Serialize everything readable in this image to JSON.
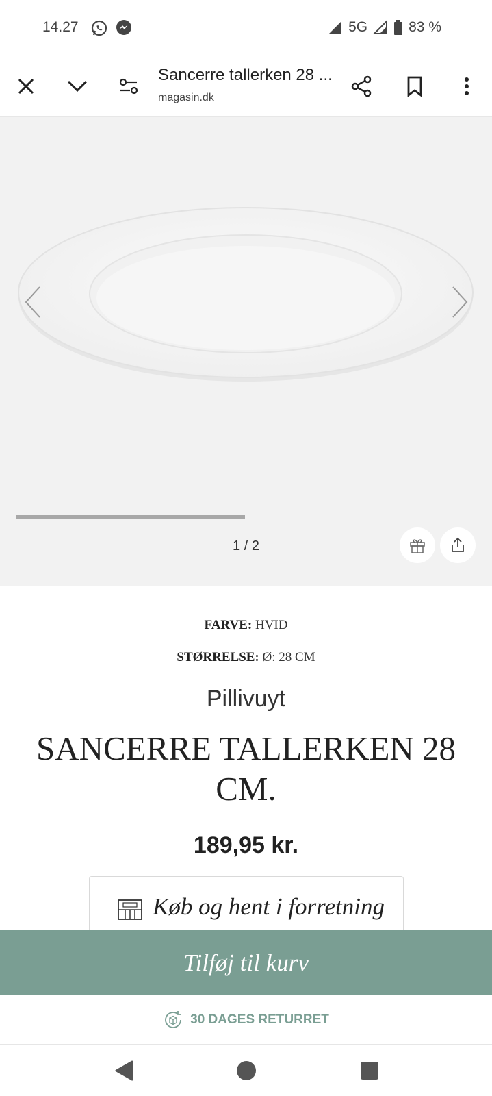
{
  "status": {
    "time": "14.27",
    "network": "5G",
    "battery": "83 %"
  },
  "toolbar": {
    "title": "Sancerre tallerken 28 ...",
    "url": "magasin.dk"
  },
  "gallery": {
    "counter": "1 / 2",
    "progress": 0.5
  },
  "product": {
    "color_label": "FARVE:",
    "color_value": "HVID",
    "size_label": "STØRRELSE:",
    "size_value": "Ø: 28 CM",
    "brand": "Pillivuyt",
    "name": "SANCERRE TALLERKEN 28 CM.",
    "price": "189,95 kr."
  },
  "actions": {
    "pickup_label": "Køb og hent i forretning",
    "cart_label": "Tilføj til kurv",
    "returns_label": "30 DAGES RETURRET"
  },
  "colors": {
    "accent": "#7a9e93",
    "gallery_bg": "#f2f2f2"
  },
  "icons": [
    "whatsapp-icon",
    "messenger-icon",
    "signal-icon",
    "battery-icon",
    "close-icon",
    "chevron-down-icon",
    "page-settings-icon",
    "share-icon",
    "bookmark-icon",
    "more-vert-icon",
    "arrow-left-icon",
    "arrow-right-icon",
    "gift-icon",
    "share-upload-icon",
    "store-icon",
    "return-box-icon",
    "nav-back-icon",
    "nav-home-icon",
    "nav-recents-icon"
  ]
}
